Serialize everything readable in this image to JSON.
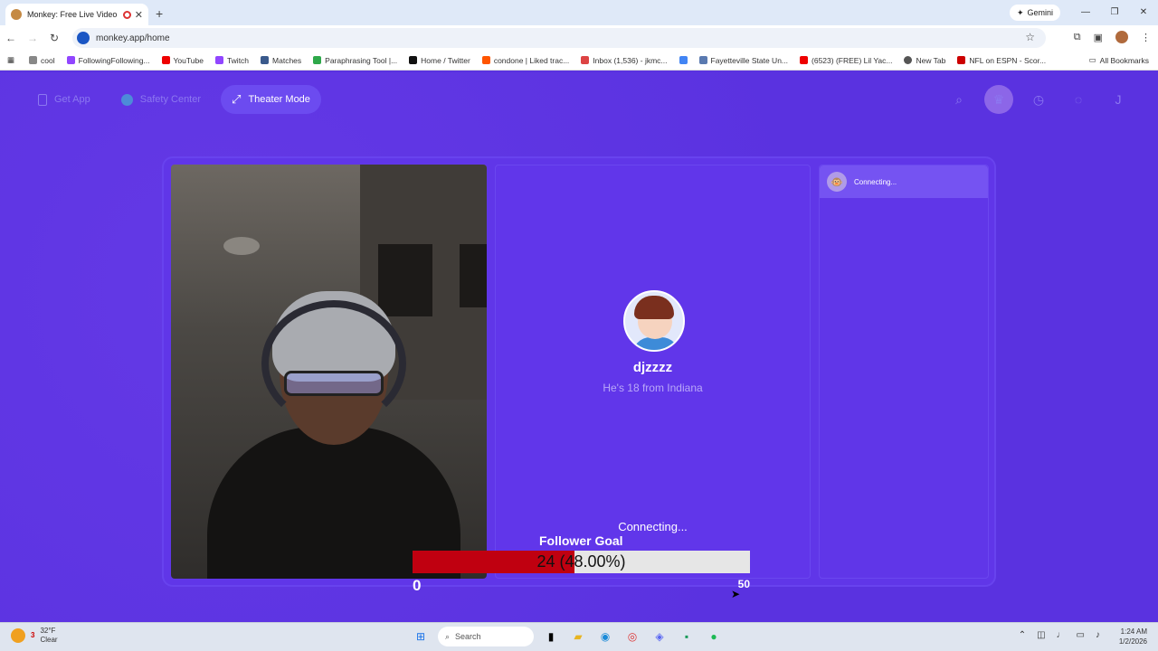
{
  "browser": {
    "tab_title": "Monkey: Free Live Video Ch",
    "tab_close": "✕",
    "new_tab": "+",
    "gemini_label": "Gemini",
    "url": "monkey.app/home",
    "bookmarks": [
      "cool",
      "FollowingFollowing...",
      "YouTube",
      "Twitch",
      "Matches",
      "Paraphrasing Tool |...",
      "Home / Twitter",
      "condone | Liked trac...",
      "Inbox (1,536) - jkmc...",
      "",
      "Fayetteville State Un...",
      "(6523) (FREE) Lil Yac...",
      "New Tab",
      "NFL on ESPN - Scor..."
    ],
    "all_bookmarks": "All Bookmarks"
  },
  "page": {
    "nav": {
      "get_app": "Get App",
      "safety_center": "Safety Center",
      "theater_mode": "Theater Mode",
      "user_initial": "J"
    },
    "match": {
      "name": "djzzzz",
      "subtitle": "He's 18 from Indiana",
      "status": "Connecting..."
    },
    "chat": {
      "status": "Connecting..."
    },
    "follower_goal": {
      "title": "Follower Goal",
      "bar_text": "24 (48.00%)",
      "min": "0",
      "max": "50",
      "progress_fraction": 0.48
    }
  },
  "taskbar": {
    "temp": "32°F",
    "condition": "Clear",
    "badge": "3",
    "search_placeholder": "Search",
    "time": "1:24 AM",
    "date": "1/2/2026"
  }
}
